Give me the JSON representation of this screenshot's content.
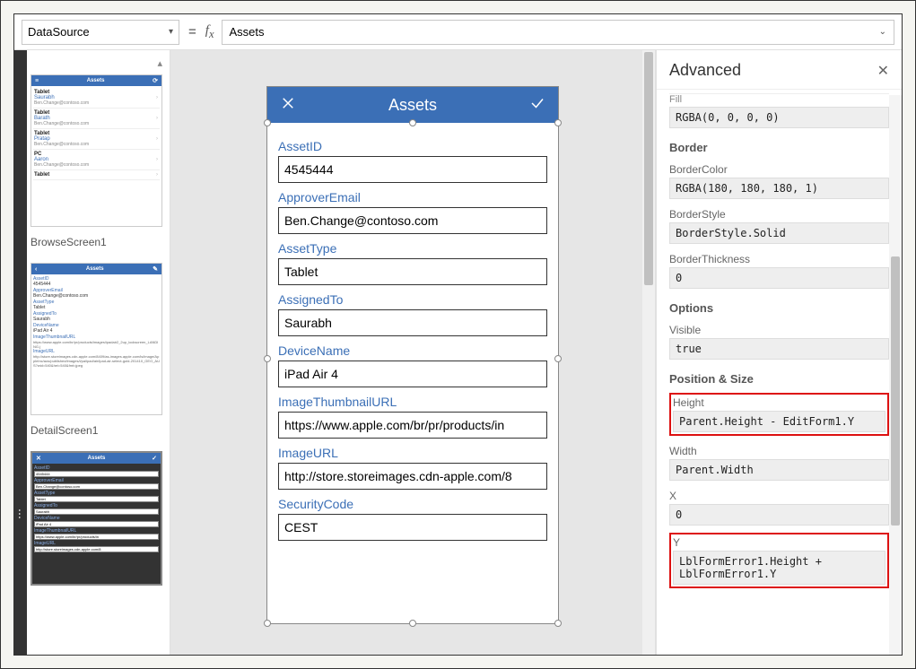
{
  "formula_bar": {
    "property": "DataSource",
    "value": "Assets"
  },
  "thumbs": {
    "browse": {
      "title": "Assets",
      "label": "BrowseScreen1",
      "rows": [
        {
          "t": "Tablet",
          "s": "Saurabh",
          "e": "Ben.Change@contoso.com"
        },
        {
          "t": "Tablet",
          "s": "Barath",
          "e": "Ben.Change@contoso.com"
        },
        {
          "t": "Tablet",
          "s": "Pratap",
          "e": "Ben.Change@contoso.com"
        },
        {
          "t": "PC",
          "s": "Aaron",
          "e": "Ben.Change@contoso.com"
        },
        {
          "t": "Tablet",
          "s": "",
          "e": ""
        }
      ]
    },
    "detail": {
      "title": "Assets",
      "label": "DetailScreen1",
      "pairs": [
        {
          "k": "AssetID",
          "v": "4545444"
        },
        {
          "k": "ApproverEmail",
          "v": "Ben.Change@contoso.com"
        },
        {
          "k": "AssetType",
          "v": "Tablet"
        },
        {
          "k": "AssignedTo",
          "v": "Saurabh"
        },
        {
          "k": "DeviceName",
          "v": "iPad Air 4"
        },
        {
          "k": "ImageThumbnailURL",
          "v": "https://www.apple.com/br/pr/products/images/ipadair2_2up_lockscreen_LANDING.j"
        },
        {
          "k": "ImageURL",
          "v": "http://store.storeimages.cdn-apple.com/8409/as-images.apple.com/is/image/AppleInc/aos/published/images/i/pa/ipad/air/ipad-air-select-gold-201410_GEO_AUS?wid=540&hei=540&fmt=jpeg"
        }
      ]
    },
    "edit": {
      "title": "Assets",
      "pairs": [
        {
          "k": "AssetID",
          "v": "4545444"
        },
        {
          "k": "ApproverEmail",
          "v": "Ben.Change@contoso.com"
        },
        {
          "k": "AssetType",
          "v": "Tablet"
        },
        {
          "k": "AssignedTo",
          "v": "Saurabh"
        },
        {
          "k": "DeviceName",
          "v": "iPad Air 4"
        },
        {
          "k": "ImageThumbnailURL",
          "v": "https://www.apple.com/br/pr/products/in"
        },
        {
          "k": "ImageURL",
          "v": "http://store.storeimages.cdn-apple.com/8"
        }
      ]
    }
  },
  "phone": {
    "header": "Assets",
    "fields": [
      {
        "label": "AssetID",
        "value": "4545444"
      },
      {
        "label": "ApproverEmail",
        "value": "Ben.Change@contoso.com"
      },
      {
        "label": "AssetType",
        "value": "Tablet"
      },
      {
        "label": "AssignedTo",
        "value": "Saurabh"
      },
      {
        "label": "DeviceName",
        "value": "iPad Air 4"
      },
      {
        "label": "ImageThumbnailURL",
        "value": "https://www.apple.com/br/pr/products/in"
      },
      {
        "label": "ImageURL",
        "value": "http://store.storeimages.cdn-apple.com/8"
      },
      {
        "label": "SecurityCode",
        "value": "CEST"
      }
    ]
  },
  "right": {
    "title": "Advanced",
    "fill_trunc": "Fill",
    "fill_value": "RGBA(0, 0, 0, 0)",
    "sections": {
      "border": "Border",
      "options": "Options",
      "pos": "Position & Size"
    },
    "props": {
      "BorderColor": "RGBA(180, 180, 180, 1)",
      "BorderStyle": "BorderStyle.Solid",
      "BorderThickness": "0",
      "Visible": "true",
      "Height": "Parent.Height - EditForm1.Y",
      "Width": "Parent.Width",
      "X": "0",
      "Y": "LblFormError1.Height + LblFormError1.Y"
    },
    "labels": {
      "BorderColor": "BorderColor",
      "BorderStyle": "BorderStyle",
      "BorderThickness": "BorderThickness",
      "Visible": "Visible",
      "Height": "Height",
      "Width": "Width",
      "X": "X",
      "Y": "Y"
    }
  }
}
